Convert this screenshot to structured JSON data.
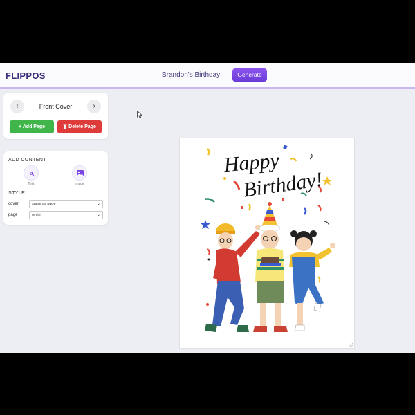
{
  "header": {
    "brand": "FLIPPOS",
    "project_title": "Brandon's Birthday",
    "generate_label": "Generate"
  },
  "page_card": {
    "page_name": "Front Cover",
    "prev_icon": "chevron-left-icon",
    "next_icon": "chevron-right-icon",
    "add_page_label": "+ Add Page",
    "delete_page_label": "Delete Page"
  },
  "content_card": {
    "add_content_title": "ADD CONTENT",
    "text_tool_label": "Text",
    "image_tool_label": "Image",
    "style_title": "STYLE",
    "cover_label": "cover",
    "cover_value": "same as page",
    "page_label": "page",
    "page_value": "white"
  },
  "canvas": {
    "greeting_line1": "Happy",
    "greeting_line2": "Birthday!"
  },
  "colors": {
    "accent": "#7a45e4",
    "add": "#3fb54a",
    "delete": "#de3b3b",
    "brand": "#3b2d7a"
  }
}
